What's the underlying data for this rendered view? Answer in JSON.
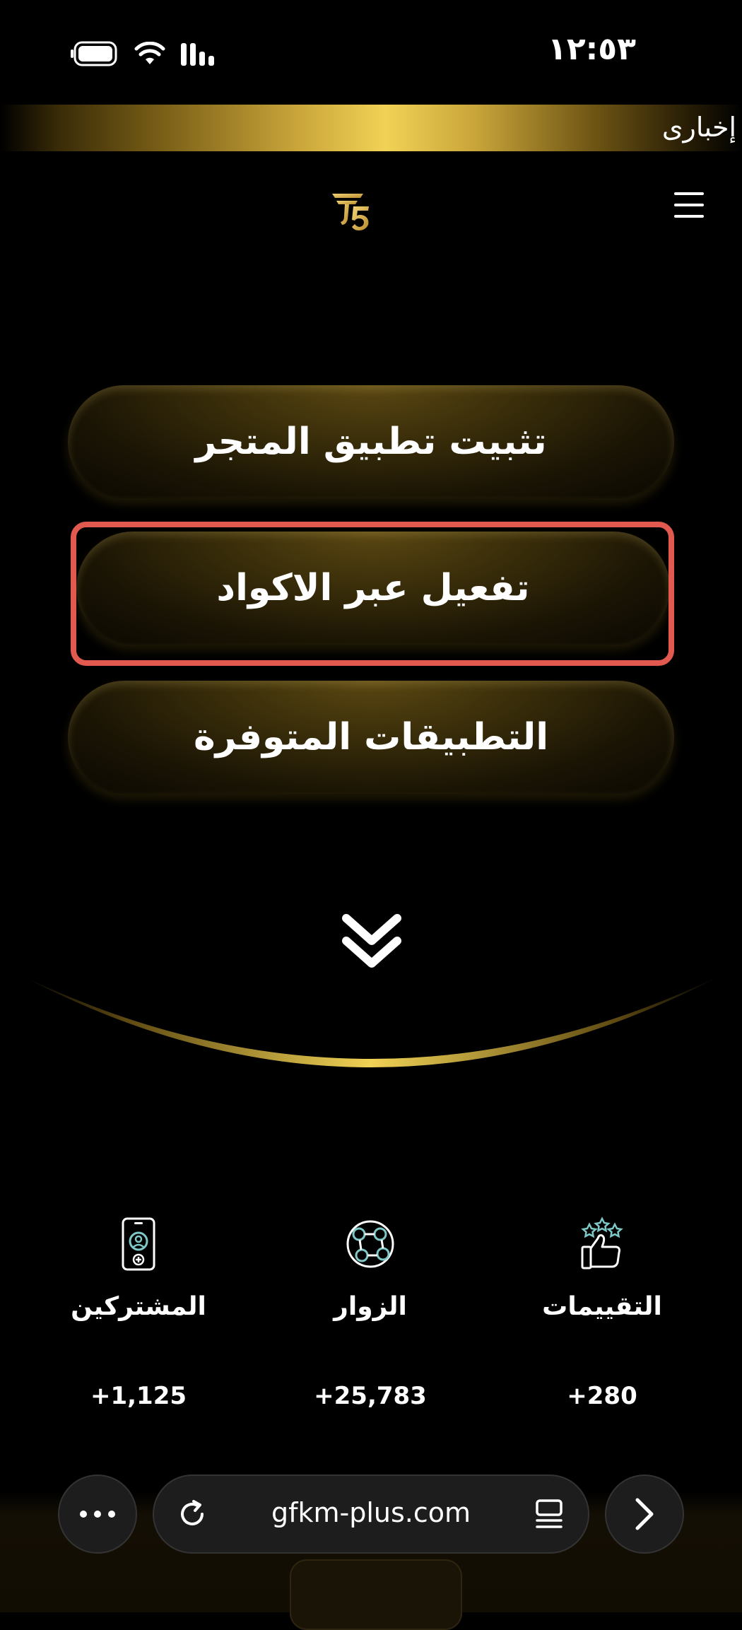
{
  "status_bar": {
    "time": "١٢:٥٣",
    "icons": [
      "battery-icon",
      "wifi-icon",
      "signal-icon"
    ]
  },
  "ticker": {
    "text": "إخبارى"
  },
  "header": {
    "menu_icon": "hamburger-menu-icon",
    "logo_icon": "gfkm-logo-icon"
  },
  "buttons": {
    "install_store": "تثبيت تطبيق المتجر",
    "activate_codes": "تفعيل عبر الاكواد",
    "available_apps": "التطبيقات المتوفرة"
  },
  "stats": [
    {
      "label": "التقييمات",
      "value": "+280",
      "icon": "thumbs-up-stars-icon"
    },
    {
      "label": "الزوار",
      "value": "+25,783",
      "icon": "globe-network-icon"
    },
    {
      "label": "المشتركين",
      "value": "+1,125",
      "icon": "phone-user-icon"
    }
  ],
  "browser": {
    "url": "gfkm-plus.com",
    "icons": [
      "more-icon",
      "reload-icon",
      "reader-mode-icon",
      "forward-icon"
    ]
  },
  "colors": {
    "gold": "#f1d255",
    "highlight": "#e25a4f",
    "teal_icon": "#7ec8c8"
  }
}
